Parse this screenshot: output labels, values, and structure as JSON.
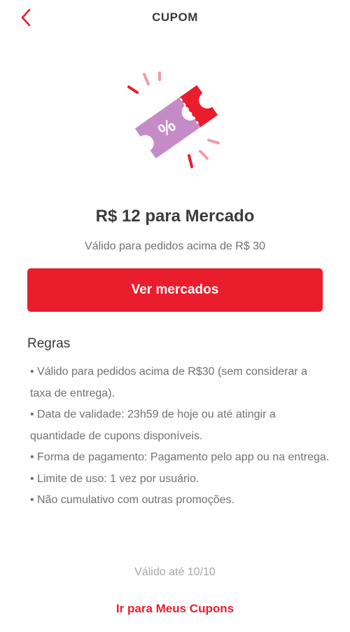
{
  "header": {
    "title": "CUPOM",
    "back_icon": "chevron-left-icon"
  },
  "illustration": {
    "icon": "coupon-ticket-icon",
    "symbol": "%",
    "colors": {
      "ticket": "#c58bc7",
      "stub": "#ea1d2c",
      "accent_light": "#f29aa6"
    }
  },
  "coupon": {
    "title": "R$ 12 para Mercado",
    "subtitle": "Válido para pedidos acima de R$ 30"
  },
  "primary_button": {
    "label": "Ver mercados"
  },
  "rules": {
    "title": "Regras",
    "items": [
      "Válido para pedidos acima de R$30 (sem considerar a taxa de entrega).",
      "Data de validade: 23h59 de hoje ou até atingir a quantidade de cupons disponíveis.",
      "Forma de pagamento: Pagamento pelo app ou na entrega.",
      "Limite de uso: 1 vez por usuário.",
      "Não cumulativo com outras promoções."
    ]
  },
  "footer": {
    "validity": "Válido até 10/10",
    "link_label": "Ir para Meus Cupons"
  },
  "colors": {
    "brand": "#ea1d2c",
    "text_primary": "#3b3b3b",
    "text_secondary": "#717171",
    "text_muted": "#a6a6a6"
  }
}
